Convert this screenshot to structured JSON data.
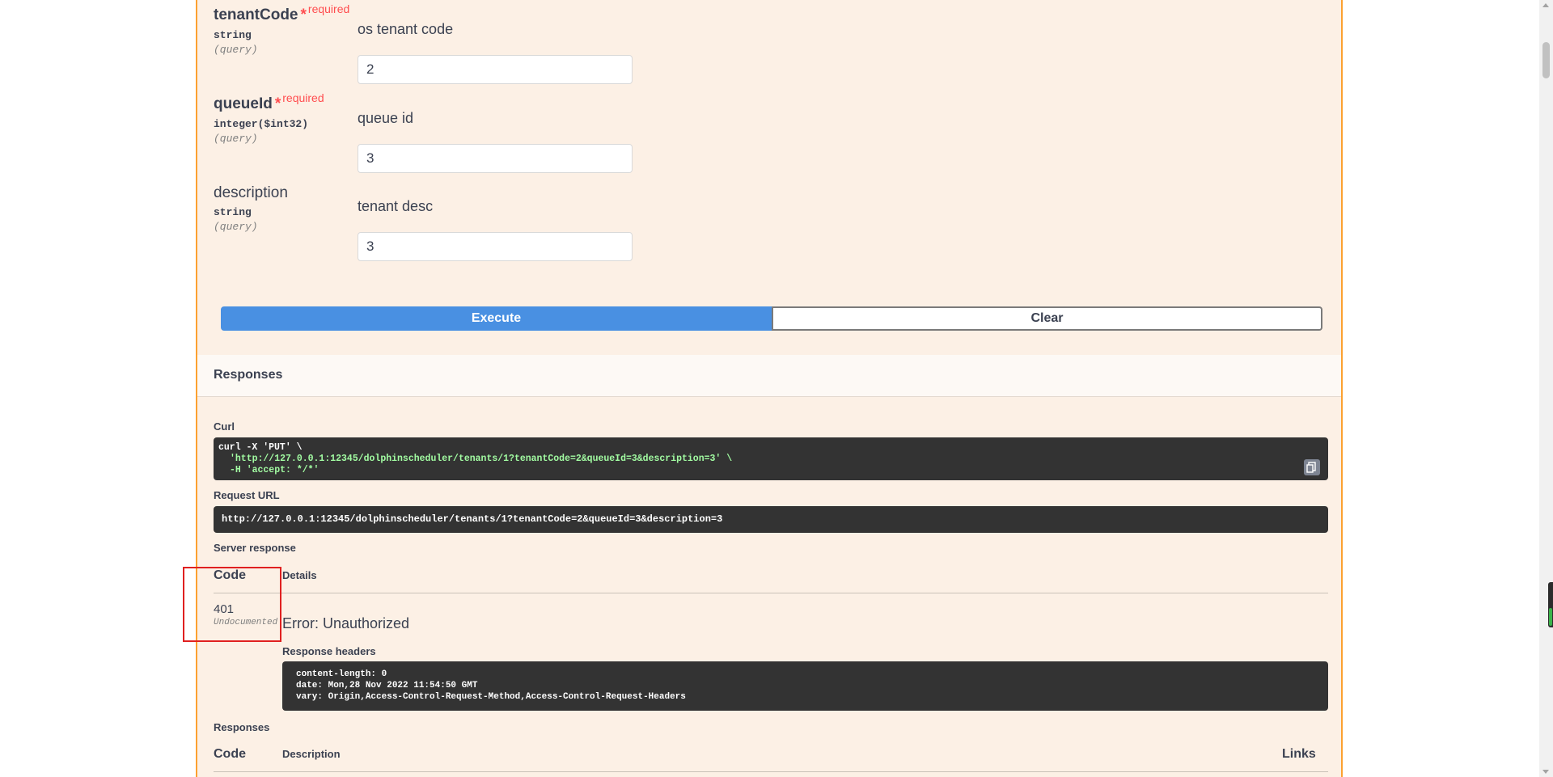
{
  "parameters": [
    {
      "name": "tenantCode",
      "required": true,
      "required_label": "required",
      "type": "string",
      "in": "(query)",
      "description": "os tenant code",
      "value": "2"
    },
    {
      "name": "queueId",
      "required": true,
      "required_label": "required",
      "type": "integer($int32)",
      "in": "(query)",
      "description": "queue id",
      "value": "3"
    },
    {
      "name": "description",
      "required": false,
      "type": "string",
      "in": "(query)",
      "description": "tenant desc",
      "value": "3"
    }
  ],
  "actions": {
    "execute_label": "Execute",
    "clear_label": "Clear"
  },
  "responses_section": {
    "title": "Responses",
    "curl_label": "Curl",
    "curl_lines": [
      "curl -X 'PUT' \\",
      "'http://127.0.0.1:12345/dolphinscheduler/tenants/1?tenantCode=2&queueId=3&description=3' \\",
      "-H 'accept: */*'"
    ],
    "request_url_label": "Request URL",
    "request_url": "http://127.0.0.1:12345/dolphinscheduler/tenants/1?tenantCode=2&queueId=3&description=3",
    "server_response_label": "Server response",
    "code_header": "Code",
    "details_header": "Details",
    "status_code": "401",
    "status_note": "Undocumented",
    "error_text": "Error: Unauthorized",
    "response_headers_label": "Response headers",
    "response_headers": [
      "content-length: 0",
      "date: Mon,28 Nov 2022 11:54:50 GMT",
      "vary: Origin,Access-Control-Request-Method,Access-Control-Request-Headers"
    ]
  },
  "documented_responses": {
    "title": "Responses",
    "code_header": "Code",
    "description_header": "Description",
    "links_header": "Links"
  },
  "colors": {
    "accent_put": "#fca130",
    "execute_blue": "#4990e2",
    "required_red": "#ff4d4f",
    "highlight_box": "#e02020"
  }
}
